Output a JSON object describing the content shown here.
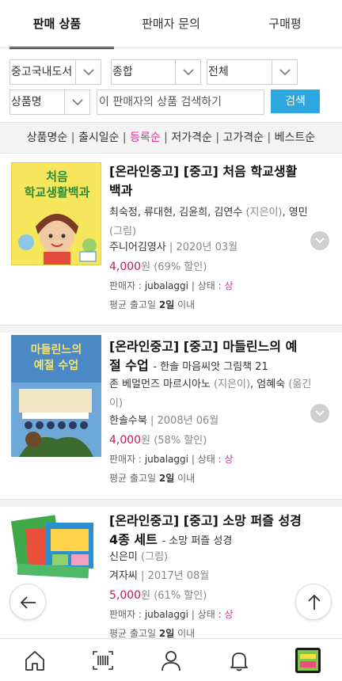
{
  "tabs": [
    {
      "label": "판매 상품",
      "active": true
    },
    {
      "label": "판매자 문의",
      "active": false
    },
    {
      "label": "구매평",
      "active": false
    }
  ],
  "filters": {
    "category": "중고국내도서",
    "sort_type": "종합",
    "range": "전체",
    "field": "상품명",
    "search_placeholder": "이 판매자의 상품 검색하기",
    "search_button": "검색"
  },
  "sort_options": [
    {
      "label": "상품명순",
      "active": false
    },
    {
      "label": "출시일순",
      "active": false
    },
    {
      "label": "등록순",
      "active": true
    },
    {
      "label": "저가격순",
      "active": false
    },
    {
      "label": "고가격순",
      "active": false
    },
    {
      "label": "베스트순",
      "active": false
    }
  ],
  "products": [
    {
      "title": "[온라인중고] [중고] 처음 학교생활백과",
      "subtitle": "",
      "authors": "최숙정, 류대현, 김윤희, 김연수",
      "authors_role": "(지은이)",
      "authors_tail": ", 영민",
      "authors_role2": "(그림)",
      "publisher": "주니어김영사",
      "date": "2020년 03월",
      "price": "4,000",
      "price_unit": "원",
      "discount": "(69% 할인)",
      "seller_label": "판매자 :",
      "seller": "jubalaggi",
      "condition_label": "| 상태 :",
      "condition": "상",
      "ship_prefix": "평균 출고일",
      "ship_days": "2일",
      "ship_suffix": "이내",
      "cover_text": [
        "처음",
        "학교생활백과"
      ]
    },
    {
      "title": "[온라인중고] [중고] 마들린느의 예절 수업",
      "subtitle": "- 한솔 마음씨앗 그림책 21",
      "authors": "존 베멀먼즈 마르시아노",
      "authors_role": "(지은이)",
      "authors_tail": ", 엄혜숙",
      "authors_role2": "(옮긴이)",
      "publisher": "한솔수북",
      "date": "2008년 06월",
      "price": "4,000",
      "price_unit": "원",
      "discount": "(58% 할인)",
      "seller_label": "판매자 :",
      "seller": "jubalaggi",
      "condition_label": "| 상태 :",
      "condition": "상",
      "ship_prefix": "평균 출고일",
      "ship_days": "2일",
      "ship_suffix": "이내",
      "cover_text": [
        "마들린느의",
        "예절 수업"
      ]
    },
    {
      "title": "[온라인중고] [중고] 소망 퍼즐 성경 4종 세트",
      "subtitle": "- 소망 퍼즐 성경",
      "authors": "신은미",
      "authors_role": "(그림)",
      "authors_tail": "",
      "authors_role2": "",
      "publisher": "겨자씨",
      "date": "2017년 08월",
      "price": "5,000",
      "price_unit": "원",
      "discount": "(61% 할인)",
      "seller_label": "판매자 :",
      "seller": "jubalaggi",
      "condition_label": "| 상태 :",
      "condition": "상",
      "ship_prefix": "평균 출고일",
      "ship_days": "2일",
      "ship_suffix": "이내"
    }
  ],
  "colors": {
    "accent_pink": "#e0329a",
    "price_color": "#c2185b",
    "search_blue": "#2ea7e0"
  },
  "nav_icons": [
    "home-icon",
    "barcode-icon",
    "user-icon",
    "bell-icon",
    "book-thumbnail-icon"
  ]
}
